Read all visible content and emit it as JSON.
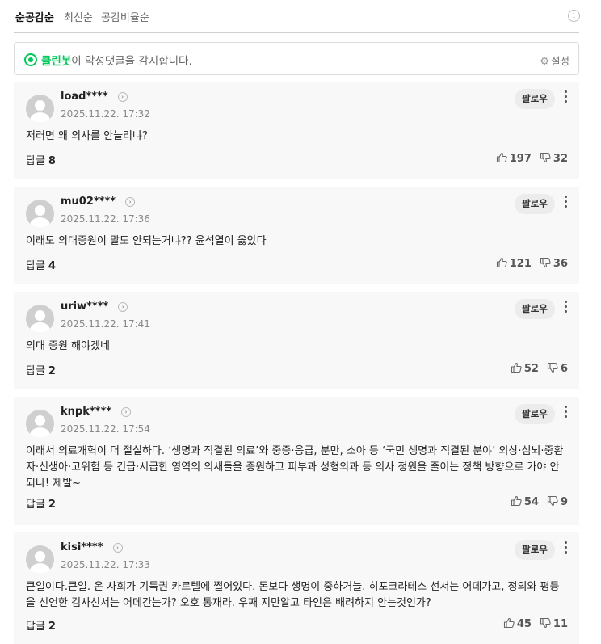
{
  "sort_tabs": [
    {
      "label": "순공감순",
      "active": true
    },
    {
      "label": "최신순",
      "active": false
    },
    {
      "label": "공감비율순",
      "active": false
    }
  ],
  "info_icon": "info-icon",
  "cleanbot": {
    "brand": "클린봇",
    "text": "이 악성댓글을 감지합니다.",
    "settings_label": "설정",
    "brand_color": "#03c75a"
  },
  "comments": [
    {
      "username": "load****",
      "timestamp": "2025.11.22. 17:32",
      "text": "저러면 왜 의사를 안늘리냐?",
      "reply_label": "답글",
      "reply_count": "8",
      "likes": "197",
      "dislikes": "32",
      "follow_label": "팔로우"
    },
    {
      "username": "mu02****",
      "timestamp": "2025.11.22. 17:36",
      "text": "이래도 의대증원이 말도 안되는거냐?? 윤석열이 옳았다",
      "reply_label": "답글",
      "reply_count": "4",
      "likes": "121",
      "dislikes": "36",
      "follow_label": "팔로우"
    },
    {
      "username": "uriw****",
      "timestamp": "2025.11.22. 17:41",
      "text": "의대 증원 해야겠네",
      "reply_label": "답글",
      "reply_count": "2",
      "likes": "52",
      "dislikes": "6",
      "follow_label": "팔로우"
    },
    {
      "username": "knpk****",
      "timestamp": "2025.11.22. 17:54",
      "text": "이래서 의료개혁이 더 절실하다. ‘생명과 직결된 의료’와 중증·응급, 분만, 소아 등 ‘국민 생명과 직결된 분야’ 외상·심뇌·중환자·신생아·고위험 등 긴급·시급한 영역의 의새들을 증원하고 피부과 성형외과 등 의사 정원을 줄이는 정책 방향으로 가야 안되나! 제발~",
      "reply_label": "답글",
      "reply_count": "2",
      "likes": "54",
      "dislikes": "9",
      "follow_label": "팔로우"
    },
    {
      "username": "kisi****",
      "timestamp": "2025.11.22. 17:33",
      "text": "큰일이다.큰일. 온 사회가 기득권 카르텔에 쩔어있다. 돈보다 생명이 중하거늘. 히포크라테스 선서는 어데가고, 정의와 평등을 선언한 검사선서는 어데간는가? 오호 통재라. 우째 지만알고 타인은 배려하지 안는것인가?",
      "reply_label": "답글",
      "reply_count": "2",
      "likes": "45",
      "dislikes": "11",
      "follow_label": "팔로우"
    }
  ]
}
